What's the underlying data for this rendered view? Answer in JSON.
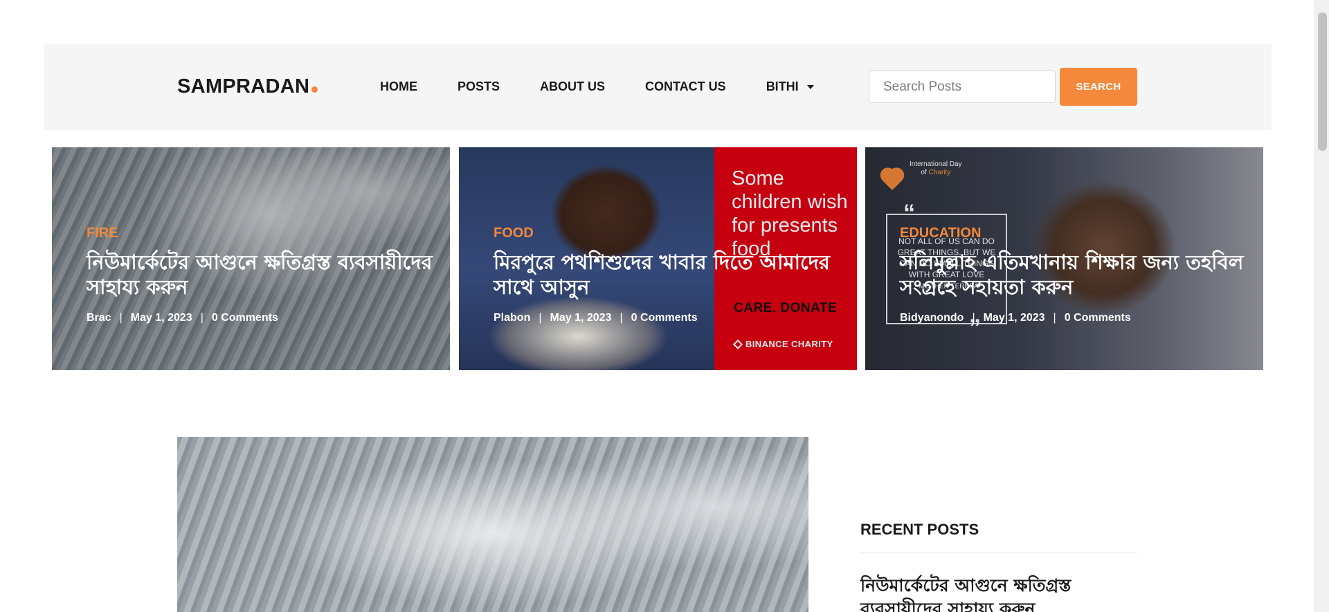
{
  "header": {
    "logo": "SAMPRADAN",
    "nav": [
      {
        "label": "HOME"
      },
      {
        "label": "POSTS"
      },
      {
        "label": "ABOUT US"
      },
      {
        "label": "CONTACT US"
      },
      {
        "label": "BITHI"
      }
    ],
    "search_placeholder": "Search Posts",
    "search_button": "SEARCH"
  },
  "cards": [
    {
      "category": "FIRE",
      "title": "নিউমার্কেটের আগুনে ক্ষতিগ্রস্ত ব্যবসায়ীদের সাহায্য করুন",
      "author": "Brac",
      "date": "May 1, 2023",
      "comments": "0 Comments"
    },
    {
      "category": "FOOD",
      "title": "মিরপুরে পথশিশুদের খাবার দিতে আমাদের সাথে আসুন",
      "author": "Plabon",
      "date": "May 1, 2023",
      "comments": "0 Comments",
      "image_text": {
        "headline": "Some children wish for presents food",
        "care": "CARE. DONATE",
        "brand": "BINANCE CHARITY"
      }
    },
    {
      "category": "EDUCATION",
      "title": "সলিমুল্লাহ এতিমখানায় শিক্ষার জন্য তহবিল সংগ্রহে সহায়তা করুন",
      "author": "Bidyanondo",
      "date": "May 1, 2023",
      "comments": "0 Comments",
      "image_text": {
        "logo_line1": "International Day",
        "logo_line2_a": "of ",
        "logo_line2_b": "Charity",
        "quote": "Not all of us can do great things. But we can do small things with great love",
        "quote_by": "- Mother Teresa"
      }
    }
  ],
  "sidebar": {
    "heading": "RECENT POSTS",
    "posts": [
      "নিউমার্কেটের আগুনে ক্ষতিগ্রস্ত ব্যবসায়ীদের সাহায্য করুন"
    ]
  },
  "colors": {
    "accent": "#f4893b",
    "header_bg": "#f5f5f5",
    "charity_red": "#d80012"
  },
  "icons": [
    "caret-down-icon",
    "binance-diamond-icon",
    "charity-heart-icon",
    "quote-icon"
  ]
}
